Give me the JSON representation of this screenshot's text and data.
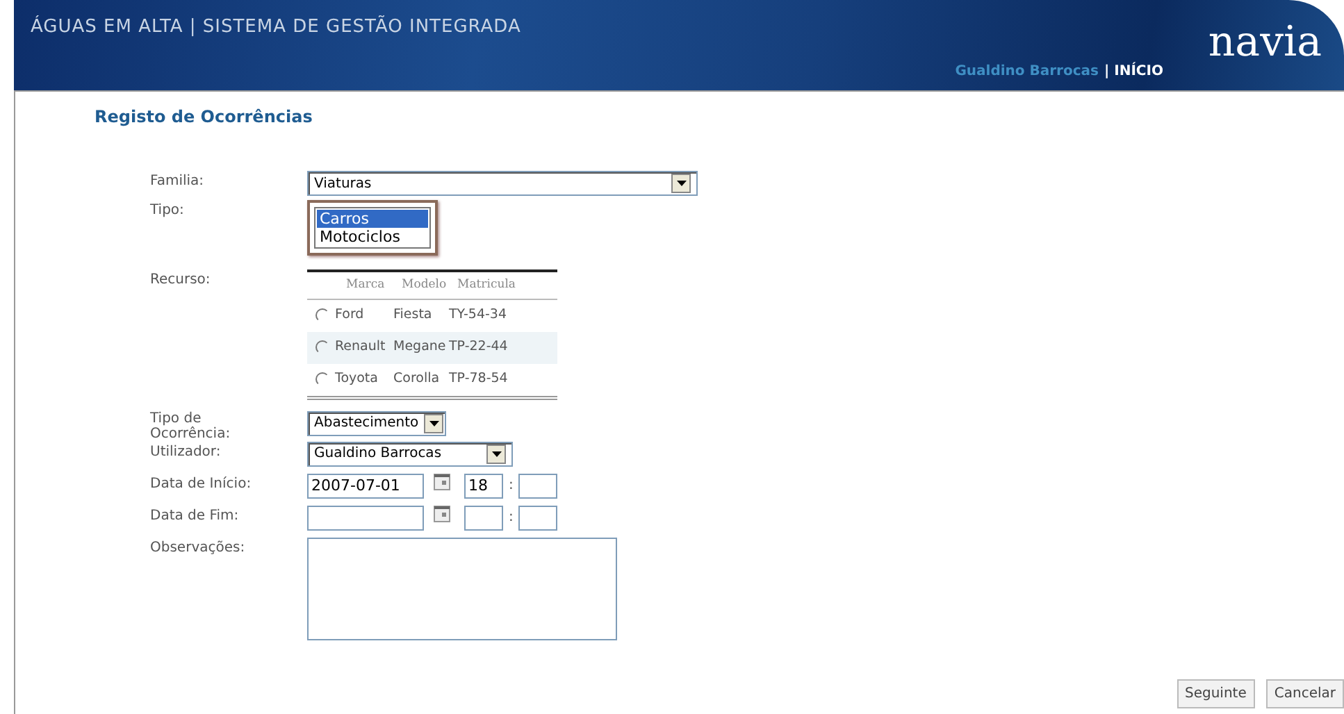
{
  "header": {
    "title": "ÁGUAS EM ALTA | SISTEMA DE GESTÃO INTEGRADA",
    "logo": "navia",
    "user": "Gualdino Barrocas",
    "home_link": "| INÍCIO"
  },
  "page_title": "Registo de Ocorrências",
  "form": {
    "familia": {
      "label": "Familia:",
      "value": "Viaturas"
    },
    "tipo": {
      "label": "Tipo:",
      "options": [
        {
          "label": "Carros",
          "selected": true
        },
        {
          "label": "Motociclos",
          "selected": false
        }
      ]
    },
    "recurso": {
      "label": "Recurso:",
      "columns": [
        "Marca",
        "Modelo",
        "Matricula"
      ],
      "rows": [
        {
          "cells": [
            "Ford",
            "Fiesta",
            "TY-54-34"
          ],
          "selected": false,
          "highlighted": false
        },
        {
          "cells": [
            "Renault",
            "Megane",
            "TP-22-44"
          ],
          "selected": false,
          "highlighted": true
        },
        {
          "cells": [
            "Toyota",
            "Corolla",
            "TP-78-54"
          ],
          "selected": false,
          "highlighted": false
        }
      ]
    },
    "tipo_ocorrencia": {
      "label": "Tipo de Ocorrência:",
      "value": "Abastecimento"
    },
    "utilizador": {
      "label": "Utilizador:",
      "value": "Gualdino Barrocas"
    },
    "data_inicio": {
      "label": "Data de Início:",
      "date": "2007-07-01",
      "hour": "18",
      "separator": ":"
    },
    "data_fim": {
      "label": "Data de Fim:",
      "separator": ":"
    },
    "observacoes": {
      "label": "Observações:"
    }
  },
  "buttons": [
    "Seguinte",
    "Cancelar"
  ]
}
